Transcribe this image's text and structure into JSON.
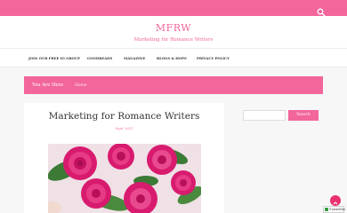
{
  "header": {
    "site_title": "MFRW",
    "tagline": "Marketing for Romance Writers"
  },
  "nav": {
    "items": [
      "JOIN OUR FREE IO GROUP",
      "GOODREADS",
      "MAGAZINE",
      "BLOGS & HOPS",
      "PRIVACY POLICY"
    ]
  },
  "breadcrumb": {
    "label": "You Are Here",
    "home": "Home"
  },
  "post": {
    "title": "Marketing for Romance Writers",
    "date": "Sept. 2021",
    "image_alt": "pink roses"
  },
  "sidebar": {
    "search_placeholder": "",
    "search_button": "Search"
  },
  "badge": {
    "text": "TrustedSite"
  },
  "colors": {
    "accent": "#f2669b",
    "scroll_button": "#e8326f"
  },
  "icons": {
    "search": "search-icon",
    "scroll_top": "chevron-up-icon"
  }
}
